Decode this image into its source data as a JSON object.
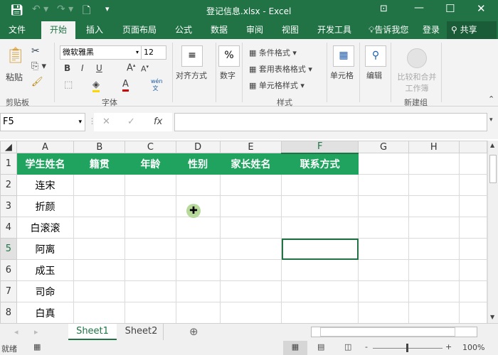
{
  "window": {
    "title": "登记信息.xlsx - Excel"
  },
  "tabs": [
    "文件",
    "开始",
    "插入",
    "页面布局",
    "公式",
    "数据",
    "审阅",
    "视图",
    "开发工具"
  ],
  "tell_me": "告诉我您",
  "login": "登录",
  "share": "共享",
  "ribbon": {
    "paste": "粘贴",
    "clipboard": "剪贴板",
    "font_name": "微软雅黑",
    "font_size": "12",
    "font_group": "字体",
    "bold": "B",
    "italic": "I",
    "underline": "U",
    "align": "对齐方式",
    "number": "数字",
    "number_icon": "%",
    "cond_format": "条件格式",
    "table_format": "套用表格格式",
    "cell_style": "单元格样式",
    "styles": "样式",
    "cells": "单元格",
    "editing": "编辑",
    "merge": "比较和合并工作簿",
    "new_group": "新建组"
  },
  "formula_bar": {
    "name_box": "F5",
    "fx": "fx",
    "value": ""
  },
  "columns": [
    "A",
    "B",
    "C",
    "D",
    "E",
    "F",
    "G",
    "H"
  ],
  "headers": [
    "学生姓名",
    "籍贯",
    "年龄",
    "性别",
    "家长姓名",
    "联系方式"
  ],
  "rows": [
    [
      "连宋"
    ],
    [
      "折颜"
    ],
    [
      "白滚滚"
    ],
    [
      "阿离"
    ],
    [
      "成玉"
    ],
    [
      "司命"
    ],
    [
      "白真"
    ]
  ],
  "row_numbers": [
    "1",
    "2",
    "3",
    "4",
    "5",
    "6",
    "7",
    "8"
  ],
  "selected_cell": "F5",
  "sheets": [
    "Sheet1",
    "Sheet2"
  ],
  "status": {
    "ready": "就绪",
    "zoom": "100%"
  },
  "colors": {
    "brand": "#217346",
    "header_fill": "#1fa35f"
  }
}
